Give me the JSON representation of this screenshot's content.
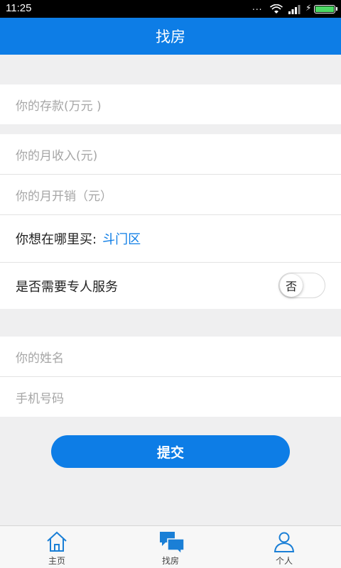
{
  "status_bar": {
    "time": "11:25",
    "dots": "..."
  },
  "header": {
    "title": "找房"
  },
  "form": {
    "savings_placeholder": "你的存款(万元 )",
    "income_placeholder": "你的月收入(元)",
    "expense_placeholder": "你的月开销（元）",
    "area_label": "你想在哪里买:",
    "area_value": "斗门区",
    "service_label": "是否需要专人服务",
    "service_toggle": "否",
    "name_placeholder": "你的姓名",
    "phone_placeholder": "手机号码",
    "submit_label": "提交"
  },
  "tabs": [
    {
      "label": "主页",
      "icon": "home-icon",
      "active": false
    },
    {
      "label": "找房",
      "icon": "chat-icon",
      "active": true
    },
    {
      "label": "个人",
      "icon": "person-icon",
      "active": false
    }
  ],
  "colors": {
    "accent": "#0d7de6",
    "background": "#efeff0"
  }
}
